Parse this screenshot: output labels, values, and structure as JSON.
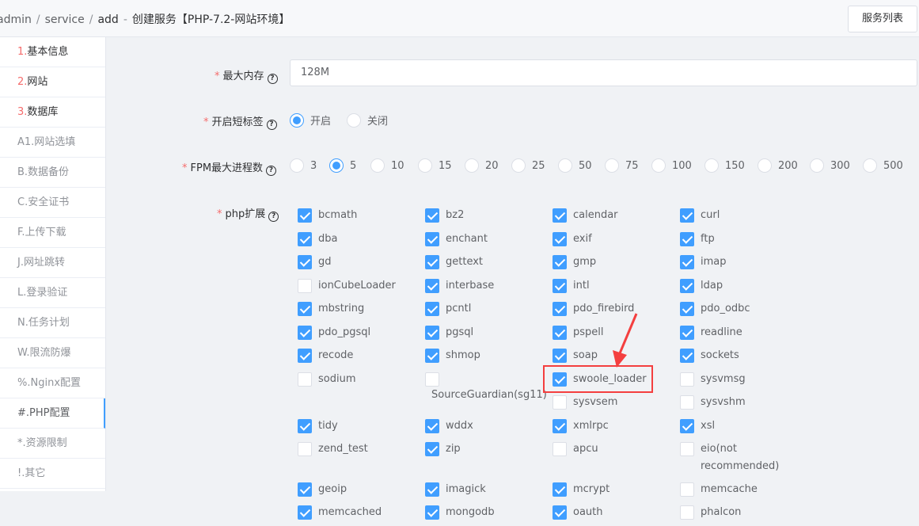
{
  "breadcrumb": {
    "items": [
      "admin",
      "service",
      "add"
    ],
    "title": "创建服务【PHP-7.2-网站环境】"
  },
  "header": {
    "service_list_label": "服务列表"
  },
  "sidebar": {
    "items": [
      {
        "num": "1.",
        "label": "基本信息"
      },
      {
        "num": "2.",
        "label": "网站"
      },
      {
        "num": "3.",
        "label": "数据库"
      },
      {
        "label": "A1.网站选填"
      },
      {
        "label": "B.数据备份"
      },
      {
        "label": "C.安全证书"
      },
      {
        "label": "F.上传下载"
      },
      {
        "label": "J.网址跳转"
      },
      {
        "label": "L.登录验证"
      },
      {
        "label": "N.任务计划"
      },
      {
        "label": "W.限流防爆"
      },
      {
        "label": "%.Nginx配置"
      },
      {
        "label": "#.PHP配置"
      },
      {
        "label": "*.资源限制"
      },
      {
        "label": "!.其它"
      }
    ]
  },
  "form": {
    "memory": {
      "label": "最大内存",
      "value": "128M"
    },
    "short_tag": {
      "label": "开启短标签",
      "options": [
        "开启",
        "关闭"
      ],
      "selected": "开启"
    },
    "fpm": {
      "label": "FPM最大进程数",
      "options": [
        "3",
        "5",
        "10",
        "15",
        "20",
        "25",
        "50",
        "75",
        "100",
        "150",
        "200",
        "300",
        "500"
      ],
      "selected": "5"
    },
    "ext": {
      "label": "php扩展"
    }
  },
  "extensions": [
    {
      "name": "bcmath",
      "checked": true
    },
    {
      "name": "bz2",
      "checked": true
    },
    {
      "name": "calendar",
      "checked": true
    },
    {
      "name": "curl",
      "checked": true
    },
    {
      "name": "dba",
      "checked": true
    },
    {
      "name": "enchant",
      "checked": true
    },
    {
      "name": "exif",
      "checked": true
    },
    {
      "name": "ftp",
      "checked": true
    },
    {
      "name": "gd",
      "checked": true
    },
    {
      "name": "gettext",
      "checked": true
    },
    {
      "name": "gmp",
      "checked": true
    },
    {
      "name": "imap",
      "checked": true
    },
    {
      "name": "ionCubeLoader",
      "checked": false
    },
    {
      "name": "interbase",
      "checked": true
    },
    {
      "name": "intl",
      "checked": true
    },
    {
      "name": "ldap",
      "checked": true
    },
    {
      "name": "mbstring",
      "checked": true
    },
    {
      "name": "pcntl",
      "checked": true
    },
    {
      "name": "pdo_firebird",
      "checked": true
    },
    {
      "name": "pdo_odbc",
      "checked": true
    },
    {
      "name": "pdo_pgsql",
      "checked": true
    },
    {
      "name": "pgsql",
      "checked": true
    },
    {
      "name": "pspell",
      "checked": true
    },
    {
      "name": "readline",
      "checked": true
    },
    {
      "name": "recode",
      "checked": true
    },
    {
      "name": "shmop",
      "checked": true
    },
    {
      "name": "soap",
      "checked": true
    },
    {
      "name": "sockets",
      "checked": true
    },
    {
      "name": "sodium",
      "checked": false
    },
    {
      "name": "SourceGuardian(sg11)",
      "checked": false
    },
    {
      "name": "swoole_loader",
      "checked": true
    },
    {
      "name": "sysvmsg",
      "checked": false
    },
    {
      "name": "sysvsem",
      "checked": false
    },
    {
      "name": "sysvshm",
      "checked": false
    },
    {
      "name": "tidy",
      "checked": true
    },
    {
      "name": "wddx",
      "checked": true
    },
    {
      "name": "xmlrpc",
      "checked": true
    },
    {
      "name": "xsl",
      "checked": true
    },
    {
      "name": "zend_test",
      "checked": false
    },
    {
      "name": "zip",
      "checked": true
    },
    {
      "name": "apcu",
      "checked": false
    },
    {
      "name": "eio(not recommended)",
      "checked": false
    },
    {
      "name": "geoip",
      "checked": true
    },
    {
      "name": "imagick",
      "checked": true
    },
    {
      "name": "mcrypt",
      "checked": true
    },
    {
      "name": "memcache",
      "checked": false
    },
    {
      "name": "memcached",
      "checked": true
    },
    {
      "name": "mongodb",
      "checked": true
    },
    {
      "name": "oauth",
      "checked": true
    },
    {
      "name": "phalcon",
      "checked": false
    }
  ],
  "colors": {
    "accent": "#409eff",
    "required": "#f56c6c",
    "annotation": "#f43f3f"
  }
}
